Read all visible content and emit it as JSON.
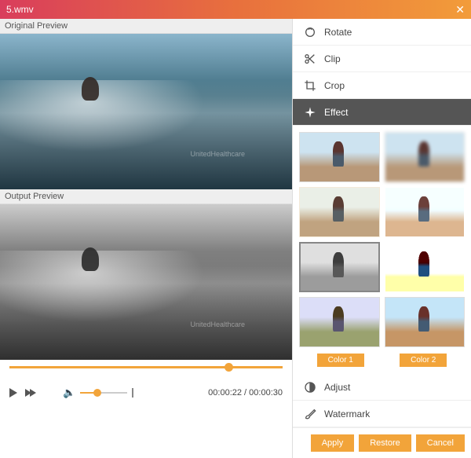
{
  "titlebar": {
    "filename": "5.wmv"
  },
  "labels": {
    "original": "Original Preview",
    "output": "Output Preview"
  },
  "watermark": "UnitedHealthcare",
  "playback": {
    "current": "00:00:22",
    "total": "00:00:30"
  },
  "menu": {
    "rotate": "Rotate",
    "clip": "Clip",
    "crop": "Crop",
    "effect": "Effect",
    "adjust": "Adjust",
    "watermark": "Watermark"
  },
  "effects": {
    "color1": "Color 1",
    "color2": "Color 2",
    "selected_index": 4
  },
  "buttons": {
    "apply": "Apply",
    "restore": "Restore",
    "cancel": "Cancel"
  }
}
